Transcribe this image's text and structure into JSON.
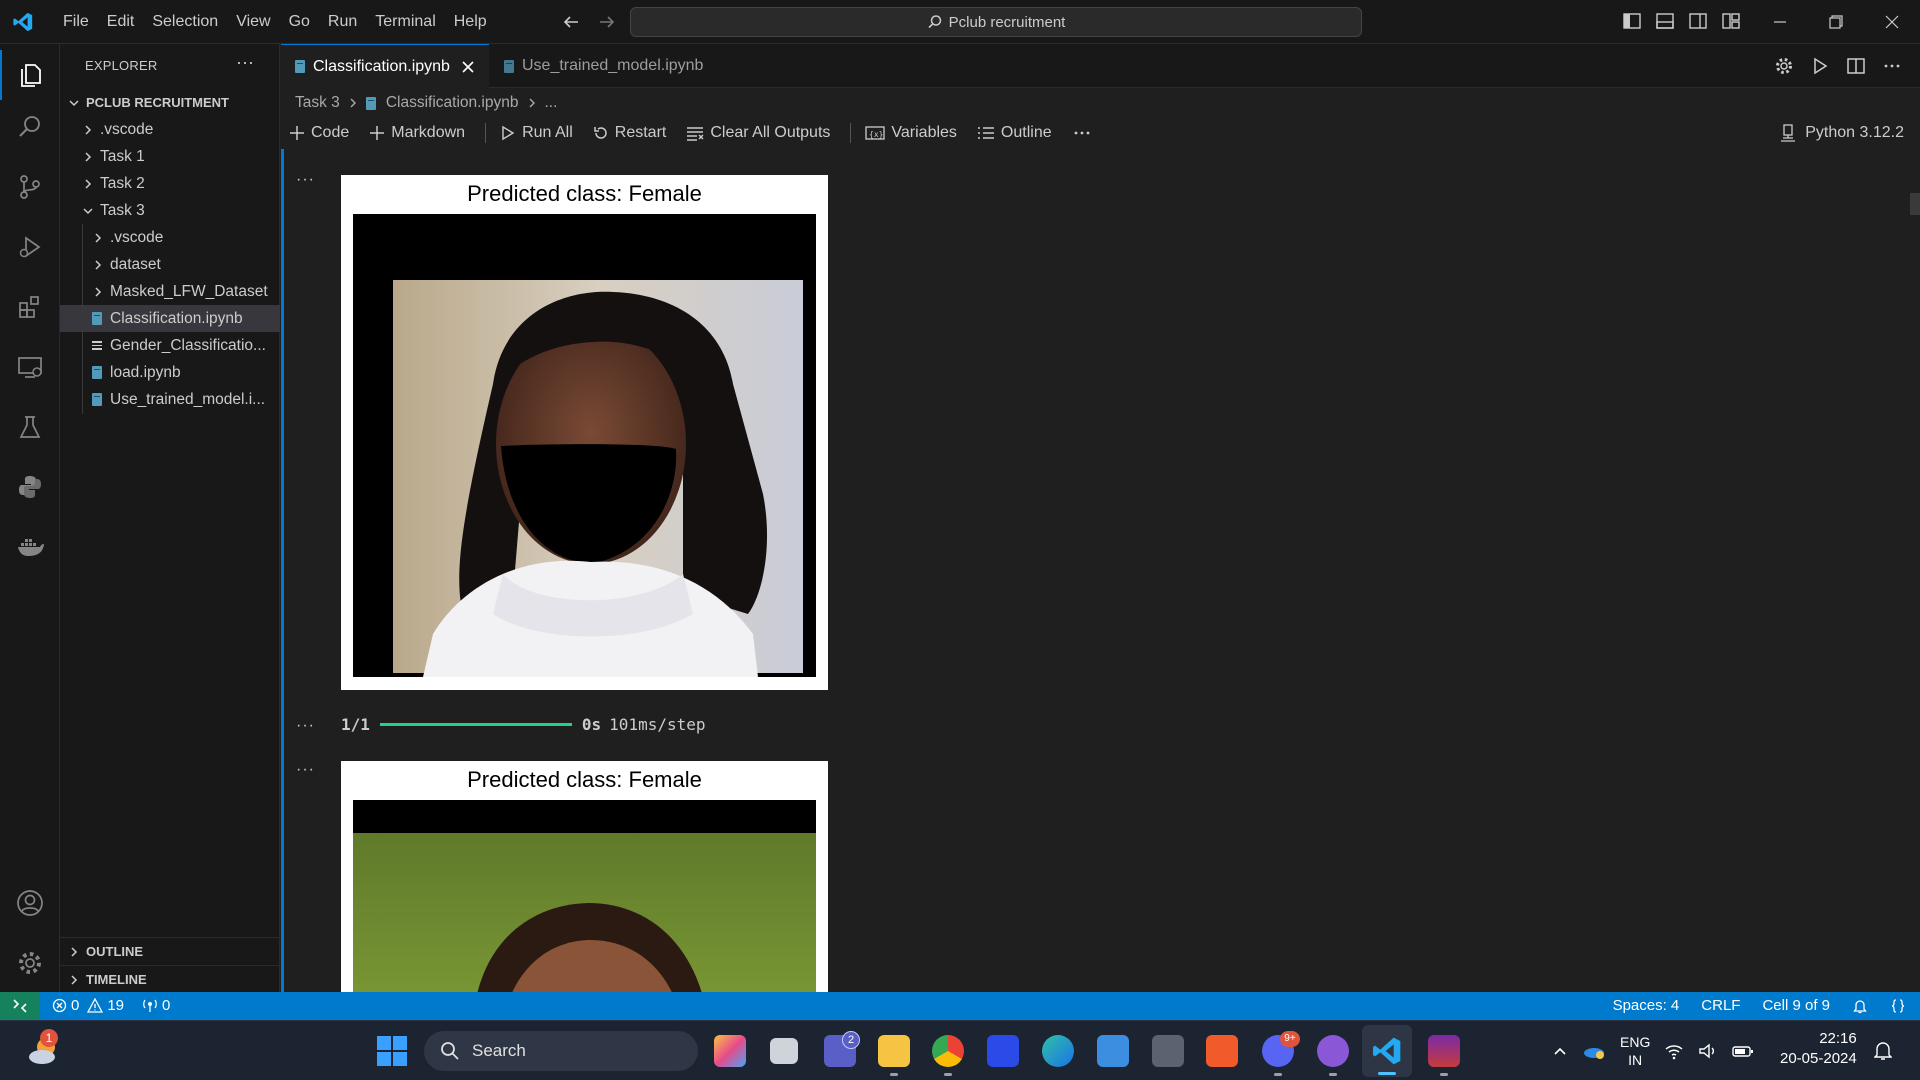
{
  "titlebar": {
    "menu": [
      "File",
      "Edit",
      "Selection",
      "View",
      "Go",
      "Run",
      "Terminal",
      "Help"
    ],
    "search_text": "Pclub recruitment"
  },
  "sidebar": {
    "header": "EXPLORER",
    "root": "PCLUB RECRUITMENT",
    "items": [
      {
        "label": ".vscode",
        "kind": "folder",
        "level": 1
      },
      {
        "label": "Task 1",
        "kind": "folder",
        "level": 1
      },
      {
        "label": "Task 2",
        "kind": "folder",
        "level": 1
      },
      {
        "label": "Task 3",
        "kind": "folder-open",
        "level": 1
      },
      {
        "label": ".vscode",
        "kind": "folder",
        "level": 2
      },
      {
        "label": "dataset",
        "kind": "folder",
        "level": 2
      },
      {
        "label": "Masked_LFW_Dataset",
        "kind": "folder",
        "level": 2
      },
      {
        "label": "Classification.ipynb",
        "kind": "notebook",
        "level": 2,
        "selected": true
      },
      {
        "label": "Gender_Classificatio...",
        "kind": "text",
        "level": 2
      },
      {
        "label": "load.ipynb",
        "kind": "notebook",
        "level": 2
      },
      {
        "label": "Use_trained_model.i...",
        "kind": "notebook",
        "level": 2
      }
    ],
    "outline_label": "OUTLINE",
    "timeline_label": "TIMELINE"
  },
  "tabs": [
    {
      "label": "Classification.ipynb",
      "active": true
    },
    {
      "label": "Use_trained_model.ipynb",
      "active": false
    }
  ],
  "breadcrumb": {
    "folder": "Task 3",
    "file": "Classification.ipynb",
    "more": "..."
  },
  "toolbar": {
    "code": "Code",
    "markdown": "Markdown",
    "run_all": "Run All",
    "restart": "Restart",
    "clear_outputs": "Clear All Outputs",
    "variables": "Variables",
    "outline": "Outline",
    "kernel": "Python 3.12.2"
  },
  "outputs": [
    {
      "title": "Predicted class: Female"
    },
    {
      "progress_count": "1/1",
      "progress_time": "0s",
      "progress_rate": "101ms/step",
      "progress_fraction": 1.0
    },
    {
      "title": "Predicted class: Female"
    }
  ],
  "statusbar": {
    "errors": "0",
    "warnings": "19",
    "ports": "0",
    "spaces": "Spaces: 4",
    "eol": "CRLF",
    "cell": "Cell 9 of 9"
  },
  "taskbar": {
    "search": "Search",
    "lang_top": "ENG",
    "lang_bottom": "IN",
    "time": "22:16",
    "date": "20-05-2024",
    "teams_badge": "2",
    "discord_badge": "9+",
    "weather_badge": "1"
  },
  "colors": {
    "accent": "#0078d4",
    "statusbar": "#007acc",
    "progress": "#23d18b"
  }
}
